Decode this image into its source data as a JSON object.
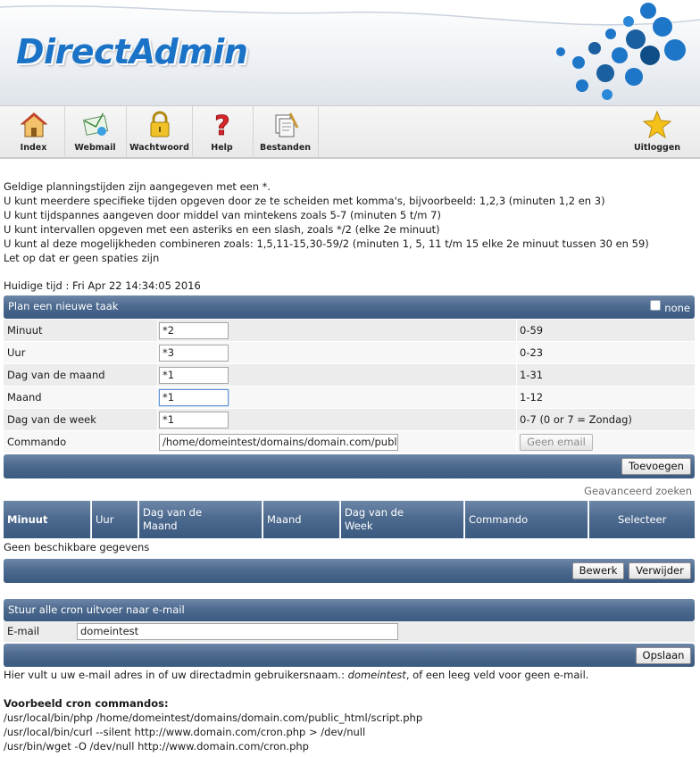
{
  "app": {
    "logo_text": "DirectAdmin"
  },
  "toolbar": {
    "items": [
      {
        "label": "Index",
        "icon": "house-icon"
      },
      {
        "label": "Webmail",
        "icon": "mail-icon"
      },
      {
        "label": "Wachtwoord",
        "icon": "padlock-icon"
      },
      {
        "label": "Help",
        "icon": "question-mark-icon"
      },
      {
        "label": "Bestanden",
        "icon": "files-icon"
      }
    ],
    "logout": {
      "label": "Uitloggen",
      "icon": "star-icon"
    }
  },
  "info": {
    "lines": [
      "Geldige planningstijden zijn aangegeven met een *.",
      "U kunt meerdere specifieke tijden opgeven door ze te scheiden met komma's, bijvoorbeeld: 1,2,3 (minuten 1,2 en 3)",
      "U kunt tijdspannes aangeven door middel van mintekens zoals 5-7 (minuten 5 t/m 7)",
      "U kunt intervallen opgeven met een asteriks en een slash, zoals */2 (elke 2e minuut)",
      "U kunt al deze mogelijkheden combineren zoals: 1,5,11-15,30-59/2 (minuten 1, 5, 11 t/m 15 elke 2e minuut tussen 30 en 59)",
      "Let op dat er geen spaties zijn"
    ],
    "current_time": "Huidige tijd : Fri Apr 22 14:34:05 2016"
  },
  "new_task": {
    "title": "Plan een nieuwe taak",
    "none_label": "none",
    "rows": [
      {
        "label": "Minuut",
        "value": "*2",
        "range": "0-59"
      },
      {
        "label": "Uur",
        "value": "*3",
        "range": "0-23"
      },
      {
        "label": "Dag van de maand",
        "value": "*1",
        "range": "1-31"
      },
      {
        "label": "Maand",
        "value": "*1",
        "range": "1-12"
      },
      {
        "label": "Dag van de week",
        "value": "*1",
        "range": "0-7 (0 or 7 = Zondag)"
      }
    ],
    "command": {
      "label": "Commando",
      "value": "/home/domeintest/domains/domain.com/publ",
      "no_email_label": "Geen email"
    },
    "add_label": "Toevoegen"
  },
  "list": {
    "advanced_search": "Geavanceerd zoeken",
    "columns": [
      "Minuut",
      "Uur",
      "Dag van de Maand",
      "Maand",
      "Dag van de Week",
      "Commando",
      "Selecteer"
    ],
    "empty_text": "Geen beschikbare gegevens",
    "edit_label": "Bewerk",
    "delete_label": "Verwijder"
  },
  "email": {
    "title": "Stuur alle cron uitvoer naar e-mail",
    "label": "E-mail",
    "value": "domeintest",
    "save_label": "Opslaan",
    "note_prefix": "Hier vult u uw e-mail adres in of uw directadmin gebruikersnaam.:",
    "note_user": "domeintest",
    "note_suffix": ", of een leeg veld voor geen e-mail."
  },
  "examples": {
    "title": "Voorbeeld cron commandos:",
    "lines": [
      "/usr/local/bin/php /home/domeintest/domains/domain.com/public_html/script.php",
      "/usr/local/bin/curl --silent http://www.domain.com/cron.php > /dev/null",
      "/usr/bin/wget -O /dev/null http://www.domain.com/cron.php"
    ]
  }
}
